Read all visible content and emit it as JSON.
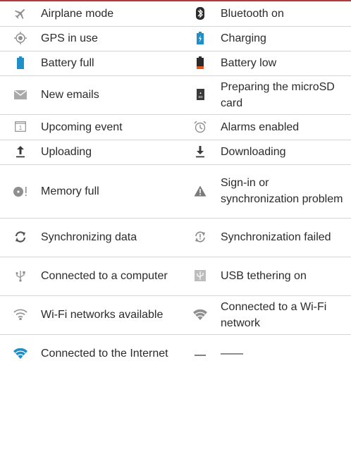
{
  "rows": [
    {
      "left": {
        "icon": "airplane-icon",
        "label": "Airplane mode"
      },
      "right": {
        "icon": "bluetooth-icon",
        "label": "Bluetooth on"
      }
    },
    {
      "left": {
        "icon": "gps-icon",
        "label": "GPS in use"
      },
      "right": {
        "icon": "battery-charging-icon",
        "label": "Charging"
      }
    },
    {
      "left": {
        "icon": "battery-full-icon",
        "label": "Battery full"
      },
      "right": {
        "icon": "battery-low-icon",
        "label": "Battery low"
      }
    },
    {
      "left": {
        "icon": "email-icon",
        "label": "New emails"
      },
      "right": {
        "icon": "sd-card-icon",
        "label": "Preparing the microSD card"
      }
    },
    {
      "left": {
        "icon": "calendar-icon",
        "label": "Upcoming event"
      },
      "right": {
        "icon": "alarm-clock-icon",
        "label": "Alarms enabled"
      }
    },
    {
      "left": {
        "icon": "upload-icon",
        "label": "Uploading"
      },
      "right": {
        "icon": "download-icon",
        "label": "Downloading"
      }
    },
    {
      "left": {
        "icon": "memory-full-icon",
        "label": "Memory full"
      },
      "right": {
        "icon": "warning-icon",
        "label": "Sign-in or synchronization problem"
      }
    },
    {
      "left": {
        "icon": "sync-icon",
        "label": "Synchronizing data"
      },
      "right": {
        "icon": "sync-failed-icon",
        "label": "Synchronization failed"
      }
    },
    {
      "left": {
        "icon": "usb-icon",
        "label": "Connected to a computer"
      },
      "right": {
        "icon": "usb-tethering-icon",
        "label": "USB tethering on"
      }
    },
    {
      "left": {
        "icon": "wifi-available-icon",
        "label": "Wi-Fi networks available"
      },
      "right": {
        "icon": "wifi-connected-icon",
        "label": "Connected to a Wi-Fi network"
      }
    },
    {
      "left": {
        "icon": "wifi-internet-icon",
        "label": "Connected to the Internet"
      },
      "right": {
        "icon": "dash",
        "label": "——"
      }
    }
  ],
  "colors": {
    "text": "#2b2b2b",
    "icon_gray": "#8f8f8f",
    "accent_blue": "#1e8fc8",
    "battery_low": "#e35a1c",
    "top_rule": "#b23a3a",
    "divider": "#d4d4d4"
  }
}
